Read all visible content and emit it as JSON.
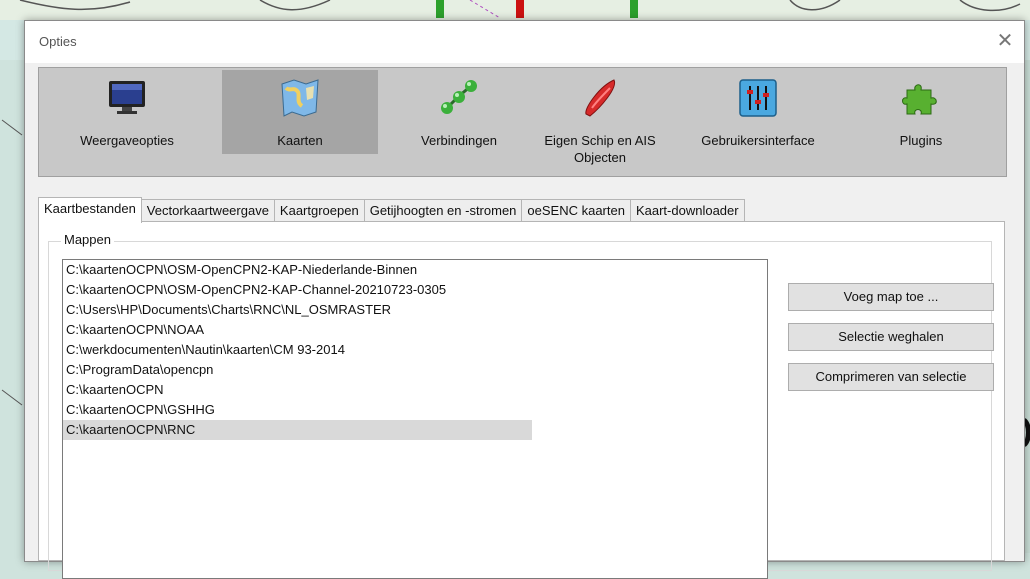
{
  "dialog": {
    "title": "Opties"
  },
  "categories": [
    {
      "id": "display",
      "label": "Weergaveopties",
      "selected": false
    },
    {
      "id": "charts",
      "label": "Kaarten",
      "selected": true
    },
    {
      "id": "connections",
      "label": "Verbindingen",
      "selected": false
    },
    {
      "id": "ownship",
      "label": "Eigen Schip en AIS Objecten",
      "selected": false
    },
    {
      "id": "ui",
      "label": "Gebruikersinterface",
      "selected": false
    },
    {
      "id": "plugins",
      "label": "Plugins",
      "selected": false
    }
  ],
  "tabs": [
    {
      "label": "Kaartbestanden",
      "active": true
    },
    {
      "label": "Vectorkaartweergave",
      "active": false
    },
    {
      "label": "Kaartgroepen",
      "active": false
    },
    {
      "label": "Getijhoogten en -stromen",
      "active": false
    },
    {
      "label": "oeSENC kaarten",
      "active": false
    },
    {
      "label": "Kaart-downloader",
      "active": false
    }
  ],
  "folders": {
    "label": "Mappen",
    "items": [
      "C:\\kaartenOCPN\\OSM-OpenCPN2-KAP-Niederlande-Binnen",
      "C:\\kaartenOCPN\\OSM-OpenCPN2-KAP-Channel-20210723-0305",
      "C:\\Users\\HP\\Documents\\Charts\\RNC\\NL_OSMRASTER",
      "C:\\kaartenOCPN\\NOAA",
      "C:\\werkdocumenten\\Nautin\\kaarten\\CM 93-2014",
      "C:\\ProgramData\\opencpn",
      "C:\\kaartenOCPN",
      "C:\\kaartenOCPN\\GSHHG",
      "C:\\kaartenOCPN\\RNC"
    ],
    "selected_index": 8
  },
  "buttons": {
    "add": "Voeg map toe ...",
    "remove": "Selectie weghalen",
    "compress": "Comprimeren van selectie"
  }
}
